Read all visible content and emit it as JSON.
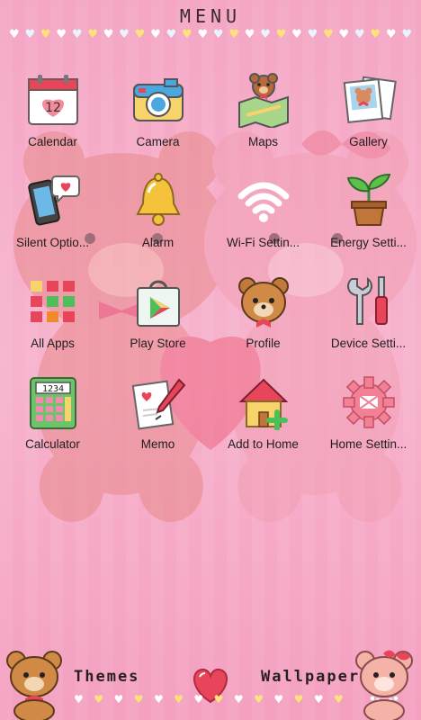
{
  "header": {
    "title": "MENU"
  },
  "apps": [
    {
      "label": "Calendar",
      "icon": "calendar-icon"
    },
    {
      "label": "Camera",
      "icon": "camera-icon"
    },
    {
      "label": "Maps",
      "icon": "maps-icon"
    },
    {
      "label": "Gallery",
      "icon": "gallery-icon"
    },
    {
      "label": "Silent Optio...",
      "icon": "silent-phone-icon"
    },
    {
      "label": "Alarm",
      "icon": "bell-icon"
    },
    {
      "label": "Wi-Fi Settin...",
      "icon": "wifi-icon"
    },
    {
      "label": "Energy Setti...",
      "icon": "plant-icon"
    },
    {
      "label": "All Apps",
      "icon": "grid-icon"
    },
    {
      "label": "Play Store",
      "icon": "play-store-bag-icon"
    },
    {
      "label": "Profile",
      "icon": "bear-face-icon"
    },
    {
      "label": "Device Setti...",
      "icon": "wrench-screwdriver-icon"
    },
    {
      "label": "Calculator",
      "icon": "calculator-icon"
    },
    {
      "label": "Memo",
      "icon": "memo-pencil-icon"
    },
    {
      "label": "Add to Home",
      "icon": "house-plus-icon"
    },
    {
      "label": "Home Settin...",
      "icon": "gear-icon"
    }
  ],
  "calendar_day": "12",
  "calculator_display": "1234",
  "dock": {
    "left_label": "Themes",
    "right_label": "Wallpapers"
  },
  "colors": {
    "background": "#f5a9c7",
    "accent_red": "#e8455a",
    "label": "#1e1e1e"
  }
}
